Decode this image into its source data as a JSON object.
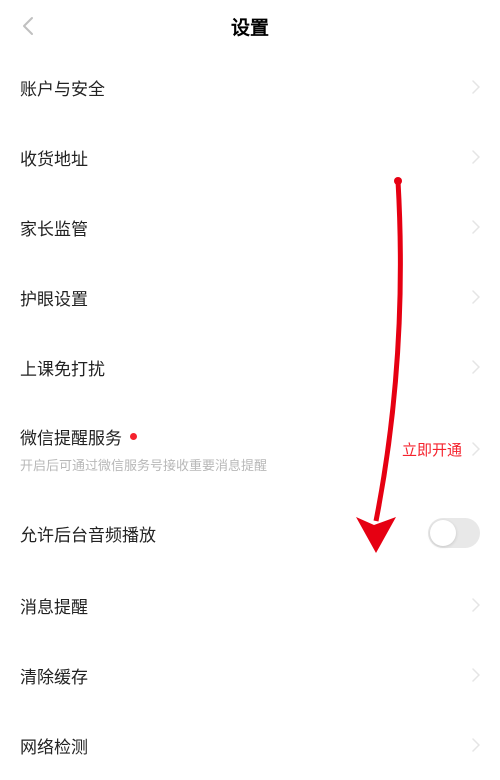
{
  "header": {
    "title": "设置"
  },
  "items": {
    "account": {
      "label": "账户与安全"
    },
    "address": {
      "label": "收货地址"
    },
    "parental": {
      "label": "家长监管"
    },
    "eye": {
      "label": "护眼设置"
    },
    "dnd": {
      "label": "上课免打扰"
    },
    "wechat": {
      "label": "微信提醒服务",
      "sub": "开启后可通过微信服务号接收重要消息提醒",
      "action": "立即开通"
    },
    "bgaudio": {
      "label": "允许后台音频播放"
    },
    "notify": {
      "label": "消息提醒"
    },
    "cache": {
      "label": "清除缓存"
    },
    "network": {
      "label": "网络检测"
    }
  }
}
